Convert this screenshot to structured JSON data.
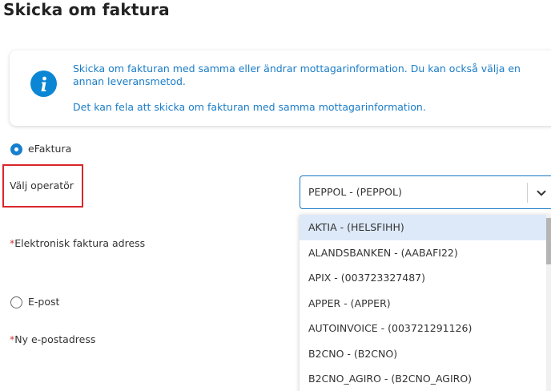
{
  "page": {
    "title": "Skicka om faktura"
  },
  "info": {
    "icon": "info-icon",
    "color": "#0a86d4",
    "text1": "Skicka om fakturan med samma eller ändrar mottagarinformation. Du kan också välja en annan leveransmetod.",
    "text2": "Det kan fela att skicka om fakturan med samma mottagarinformation."
  },
  "delivery": {
    "efaktura_label": "eFaktura",
    "efaktura_selected": true,
    "epost_label": "E-post",
    "epost_selected": false
  },
  "form": {
    "operator_label": "Välj operatör",
    "operator_value": "PEPPOL - (PEPPOL)",
    "required_marker": "*",
    "einvoice_address_label": "Elektronisk faktura adress",
    "new_email_label": "Ny e-postadress"
  },
  "dropdown": {
    "items": [
      "AKTIA - (HELSFIHH)",
      "ALANDSBANKEN - (AABAFI22)",
      "APIX - (003723327487)",
      "APPER - (APPER)",
      "AUTOINVOICE - (003721291126)",
      "B2CNO - (B2CNO)",
      "B2CNO_AGIRO - (B2CNO_AGIRO)"
    ],
    "highlighted_index": 0
  },
  "colors": {
    "accent": "#1a7cc7",
    "highlight_border": "#d9262b",
    "required": "#d23a3a",
    "active_item_bg": "#dde9f8"
  }
}
